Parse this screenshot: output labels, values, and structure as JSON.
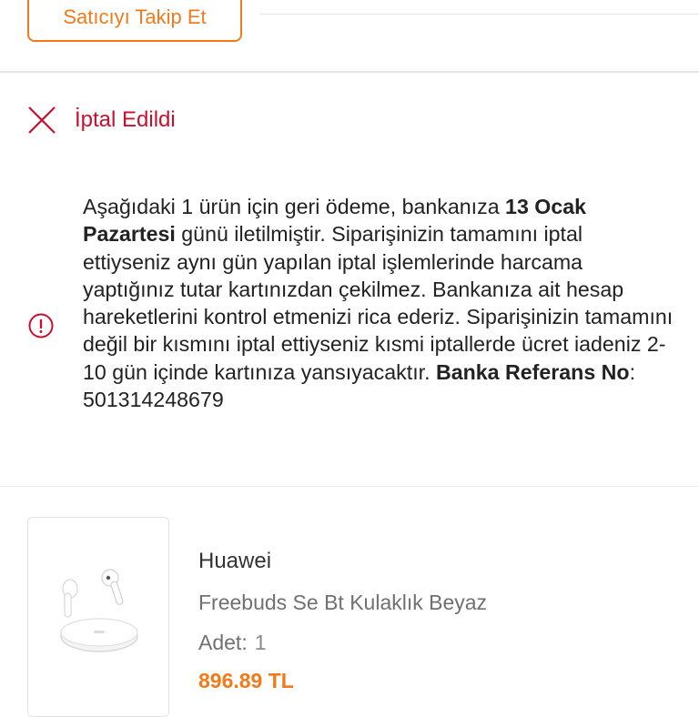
{
  "seller": {
    "follow_label": "Satıcıyı Takip Et"
  },
  "status": {
    "label": "İptal Edildi",
    "color": "#c8102e",
    "icon": "close-icon"
  },
  "refund_info": {
    "icon": "info-icon",
    "part1": "Aşağıdaki 1 ürün için geri ödeme, bankanıza ",
    "date_bold": "13 Ocak Pazartesi",
    "part2": " günü iletilmiştir. Siparişinizin tamamını iptal ettiyseniz aynı gün yapılan iptal işlemlerinde harcama yaptığınız tutar kartınızdan çekilmez. Bankanıza ait hesap hareketlerini kontrol etmenizi rica ederiz. Siparişinizin tamamını değil bir kısmını iptal ettiyseniz kısmi iptallerde ücret iadeniz 2-10 gün içinde kartınıza yansıyacaktır. ",
    "ref_label": "Banka Referans No",
    "ref_sep": ":",
    "ref_number": "501314248679"
  },
  "product": {
    "brand": "Huawei",
    "name": "Freebuds Se Bt Kulaklık Beyaz",
    "qty_label": "Adet:",
    "qty_value": "1",
    "price": "896.89 TL",
    "image_icon": "earbuds-icon"
  },
  "colors": {
    "accent": "#f27a1a",
    "cancel": "#c8102e"
  }
}
